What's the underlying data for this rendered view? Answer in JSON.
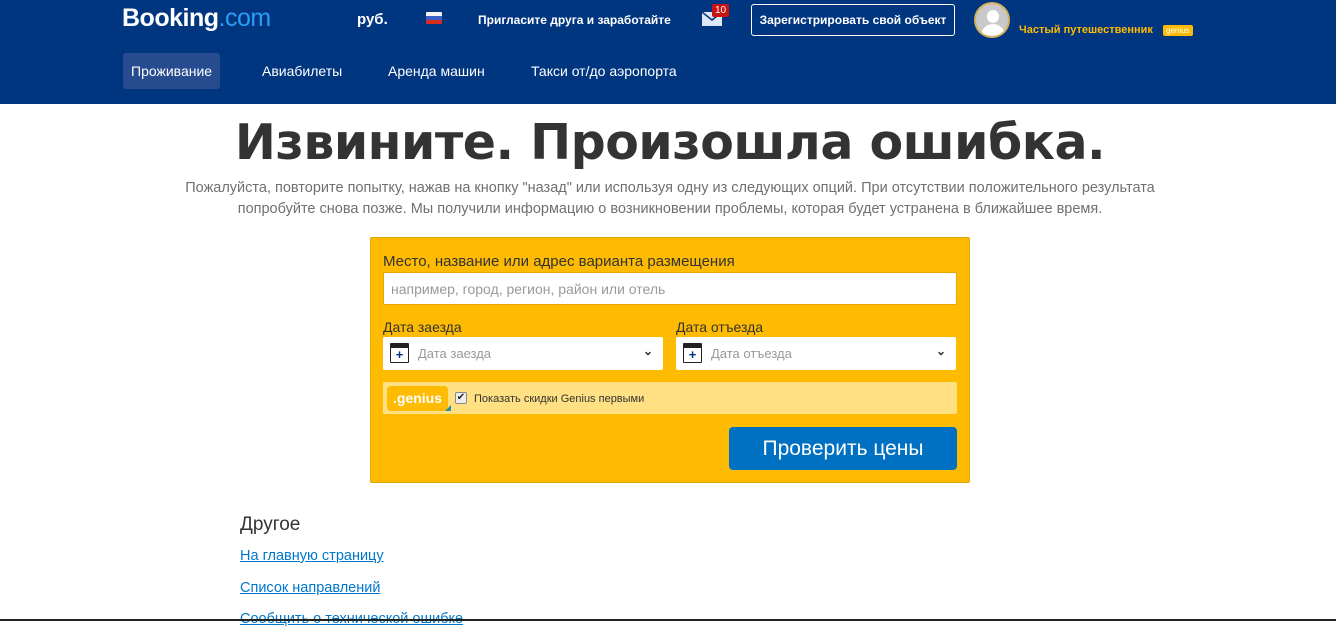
{
  "header": {
    "logo_main": "Booking",
    "logo_suffix": ".com",
    "currency": "руб.",
    "language_flag": "russia-flag",
    "invite_link": "Пригласите друга и заработайте",
    "messages_count": "10",
    "register_button": "Зарегистрировать свой объект",
    "user_level": "Частый путешественник",
    "genius_badge": "genius"
  },
  "nav": {
    "items": [
      {
        "label": "Проживание",
        "active": true
      },
      {
        "label": "Авиабилеты",
        "active": false
      },
      {
        "label": "Аренда машин",
        "active": false
      },
      {
        "label": "Такси от/до аэропорта",
        "active": false
      }
    ]
  },
  "error": {
    "title": "Извините. Произошла ошибка.",
    "line1": "Пожалуйста, повторите попытку, нажав на кнопку \"назад\" или используя одну из следующих опций. При отсутствии положительного результата",
    "line2": "попробуйте снова позже. Мы получили информацию о возникновении проблемы, которая будет устранена в ближайшее время."
  },
  "search": {
    "destination_label": "Место, название или адрес варианта размещения",
    "destination_placeholder": "например, город, регион, район или отель",
    "destination_value": "",
    "checkin_label": "Дата заезда",
    "checkin_placeholder": "Дата заезда",
    "checkout_label": "Дата отъезда",
    "checkout_placeholder": "Дата отъезда",
    "genius_logo": ".genius",
    "genius_checkbox_label": "Показать скидки Genius первыми",
    "genius_checked": true,
    "submit_button": "Проверить цены"
  },
  "other": {
    "title": "Другое",
    "links": [
      "На главную страницу",
      "Список направлений",
      "Сообщить о технической ошибке"
    ]
  },
  "colors": {
    "brand_blue": "#003580",
    "accent_yellow": "#febb02",
    "button_blue": "#0071c2",
    "link_blue": "#0077cc"
  }
}
